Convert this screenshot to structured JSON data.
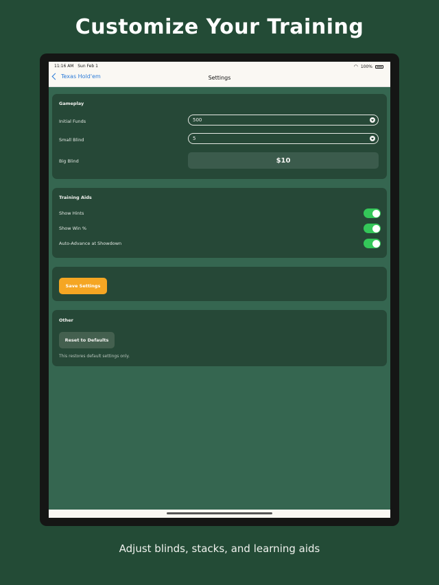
{
  "headline": "Customize Your Training",
  "caption": "Adjust blinds, stacks, and learning aids",
  "statusbar": {
    "time": "11:16 AM",
    "date": "Sun Feb 1",
    "battery": "100%"
  },
  "navbar": {
    "back_label": "Texas Hold'em",
    "title": "Settings"
  },
  "gameplay": {
    "title": "Gameplay",
    "initial_funds_label": "Initial Funds",
    "initial_funds_value": "500",
    "small_blind_label": "Small Blind",
    "small_blind_value": "5",
    "big_blind_label": "Big Blind",
    "big_blind_value": "$10"
  },
  "training_aids": {
    "title": "Training Aids",
    "items": [
      {
        "label": "Show Hints",
        "on": true
      },
      {
        "label": "Show Win %",
        "on": true
      },
      {
        "label": "Auto-Advance at Showdown",
        "on": true
      }
    ]
  },
  "save": {
    "label": "Save Settings"
  },
  "other": {
    "title": "Other",
    "reset_label": "Reset to Defaults",
    "note": "This restores default settings only."
  },
  "colors": {
    "background": "#234b36",
    "screen": "#356650",
    "card": "#264837",
    "accent": "#f5a623",
    "toggle_on": "#34c759",
    "link": "#2a7ad8"
  }
}
